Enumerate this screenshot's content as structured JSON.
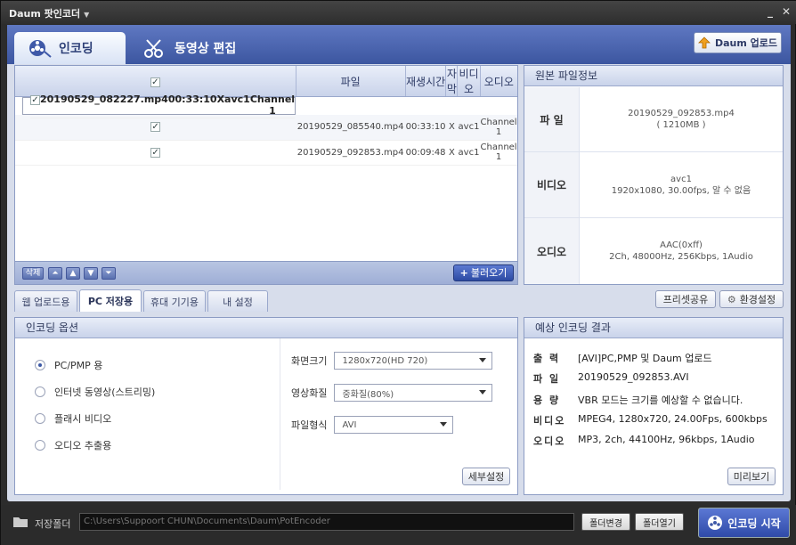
{
  "window": {
    "title": "Daum 팟인코더"
  },
  "tabs": {
    "encoding": "인코딩",
    "edit": "동영상 편집"
  },
  "upload_button": "Daum 업로드",
  "file_list": {
    "columns": [
      "파일",
      "재생시간",
      "자막",
      "비디오",
      "오디오"
    ],
    "rows": [
      {
        "name": "20190529_082227.mp4",
        "duration": "00:33:10",
        "subtitle": "X",
        "video": "avc1",
        "audio": "Channel 1"
      },
      {
        "name": "20190529_085540.mp4",
        "duration": "00:33:10",
        "subtitle": "X",
        "video": "avc1",
        "audio": "Channel 1"
      },
      {
        "name": "20190529_092853.mp4",
        "duration": "00:09:48",
        "subtitle": "X",
        "video": "avc1",
        "audio": "Channel 1"
      }
    ],
    "delete_label": "삭제",
    "load_label": "불러오기"
  },
  "source_info": {
    "title": "원본 파일정보",
    "file_label": "파  일",
    "file_value": "20190529_092853.mp4",
    "file_size": "( 1210MB )",
    "video_label": "비디오",
    "video_codec": "avc1",
    "video_detail": "1920x1080, 30.00fps, 알 수 없음",
    "audio_label": "오디오",
    "audio_codec": "AAC(0xff)",
    "audio_detail": "2Ch, 48000Hz, 256Kbps, 1Audio"
  },
  "sub_tabs": [
    "웹 업로드용",
    "PC 저장용",
    "휴대 기기용",
    "내 설정"
  ],
  "preset_share": "프리셋공유",
  "env_settings": "환경설정",
  "options": {
    "title": "인코딩 옵션",
    "radios": [
      "PC/PMP 용",
      "인터넷 동영상(스트리밍)",
      "플래시 비디오",
      "오디오 추출용"
    ],
    "screen_label": "화면크기",
    "screen_value": "1280x720(HD 720)",
    "quality_label": "영상화질",
    "quality_value": "중화질(80%)",
    "format_label": "파일형식",
    "format_value": "AVI",
    "detail_button": "세부설정"
  },
  "result": {
    "title": "예상 인코딩 결과",
    "rows": [
      {
        "k": "출 력",
        "v": "[AVI]PC,PMP 및 Daum 업로드"
      },
      {
        "k": "파 일",
        "v": "20190529_092853.AVI"
      },
      {
        "k": "용 량",
        "v": "VBR 모드는 크기를 예상할 수 없습니다."
      },
      {
        "k": "비디오",
        "v": "MPEG4, 1280x720, 24.00Fps, 600kbps"
      },
      {
        "k": "오디오",
        "v": "MP3, 2ch, 44100Hz, 96kbps, 1Audio"
      }
    ],
    "preview_button": "미리보기"
  },
  "bottom": {
    "folder_label": "저장폴더",
    "path": "C:\\Users\\Suppoort CHUN\\Documents\\Daum\\PotEncoder",
    "change_button": "폴더변경",
    "open_button": "폴더열기",
    "start_button": "인코딩 시작"
  },
  "colors": {
    "accent": "#3d5aa6",
    "frame": "#2c2c2c"
  }
}
